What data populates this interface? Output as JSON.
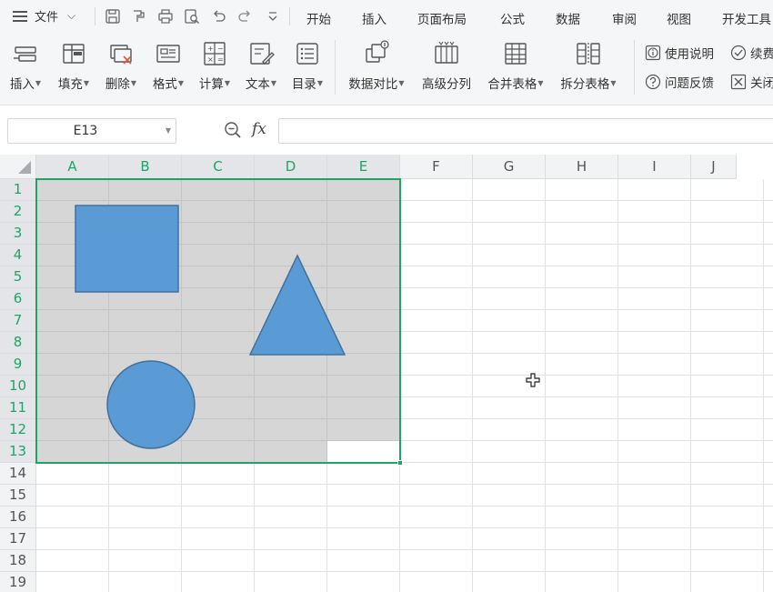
{
  "menubar": {
    "file_label": "文件",
    "tabs": [
      "开始",
      "插入",
      "页面布局",
      "公式",
      "数据",
      "审阅",
      "视图",
      "开发工具"
    ]
  },
  "ribbon": {
    "buttons": [
      {
        "label": "插入",
        "icon": "insert-rows-icon",
        "dropdown": true
      },
      {
        "label": "填充",
        "icon": "fill-icon",
        "dropdown": true
      },
      {
        "label": "删除",
        "icon": "delete-icon",
        "dropdown": true
      },
      {
        "label": "格式",
        "icon": "format-icon",
        "dropdown": true
      },
      {
        "label": "计算",
        "icon": "calculator-icon",
        "dropdown": true
      },
      {
        "label": "文本",
        "icon": "text-edit-icon",
        "dropdown": true
      },
      {
        "label": "目录",
        "icon": "table-of-contents-icon",
        "dropdown": true
      },
      {
        "label": "数据对比",
        "icon": "data-compare-icon",
        "dropdown": true
      },
      {
        "label": "高级分列",
        "icon": "split-columns-icon",
        "dropdown": false
      },
      {
        "label": "合并表格",
        "icon": "merge-tables-icon",
        "dropdown": true
      },
      {
        "label": "拆分表格",
        "icon": "split-table-icon",
        "dropdown": true
      }
    ],
    "help_label": "使用说明",
    "feedback_label": "问题反馈",
    "renew_label": "续费",
    "close_label": "关闭"
  },
  "formula_bar": {
    "name_box": "E13",
    "fx_label": "fx",
    "formula_value": ""
  },
  "grid": {
    "columns": [
      "A",
      "B",
      "C",
      "D",
      "E",
      "F",
      "G",
      "H",
      "I",
      "J"
    ],
    "rows": [
      "1",
      "2",
      "3",
      "4",
      "5",
      "6",
      "7",
      "8",
      "9",
      "10",
      "11",
      "12",
      "13",
      "14",
      "15",
      "16",
      "17",
      "18",
      "19"
    ],
    "selection": "A1:E13",
    "active_cell": "E13",
    "selected_columns": [
      "A",
      "B",
      "C",
      "D",
      "E"
    ],
    "selected_rows_count": 13
  },
  "shapes": [
    {
      "type": "rectangle",
      "name": "blue-square"
    },
    {
      "type": "triangle",
      "name": "blue-triangle"
    },
    {
      "type": "circle",
      "name": "blue-circle"
    }
  ],
  "colors": {
    "accent_green": "#21a366",
    "shape_fill": "#5b9bd5",
    "shape_stroke": "#41719c",
    "selection_fill": "#d6d6d6"
  }
}
